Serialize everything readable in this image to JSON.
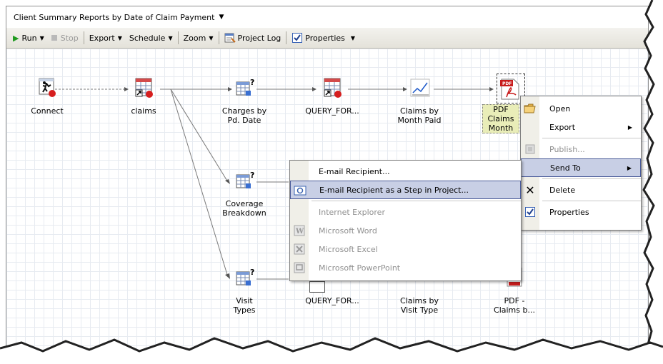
{
  "window": {
    "title": "Client Summary Reports by Date of Claim Payment"
  },
  "toolbar": {
    "run": "Run",
    "stop": "Stop",
    "export": "Export",
    "schedule": "Schedule",
    "zoom": "Zoom",
    "project_log": "Project Log",
    "properties": "Properties"
  },
  "nodes": {
    "connect": "Connect",
    "claims": "claims",
    "charges_l1": "Charges by",
    "charges_l2": "Pd. Date",
    "query_top": "QUERY_FOR...",
    "claims_month_l1": "Claims by",
    "claims_month_l2": "Month Paid",
    "pdf_top_l1": "PDF",
    "pdf_top_l2": "Claims",
    "pdf_top_l3": "Month",
    "coverage_l1": "Coverage",
    "coverage_l2": "Breakdown",
    "visit_l1": "Visit",
    "visit_l2": "Types",
    "query_bottom": "QUERY_FOR...",
    "claims_visit_l1": "Claims by",
    "claims_visit_l2": "Visit Type",
    "pdf_bottom_l1": "PDF -",
    "pdf_bottom_l2": "Claims b..."
  },
  "context_menu": {
    "open": "Open",
    "export": "Export",
    "publish": "Publish...",
    "send_to": "Send To",
    "delete": "Delete",
    "properties": "Properties"
  },
  "send_to_menu": {
    "email_recipient": "E-mail Recipient...",
    "email_step": "E-mail Recipient as a Step in Project...",
    "ie": "Internet Explorer",
    "word": "Microsoft Word",
    "excel": "Microsoft Excel",
    "powerpoint": "Microsoft PowerPoint"
  },
  "colors": {
    "highlight": "#c8cfe5",
    "highlight_border": "#4a5b99",
    "grid": "#e7ebf1",
    "run_green": "#2ca02c"
  }
}
